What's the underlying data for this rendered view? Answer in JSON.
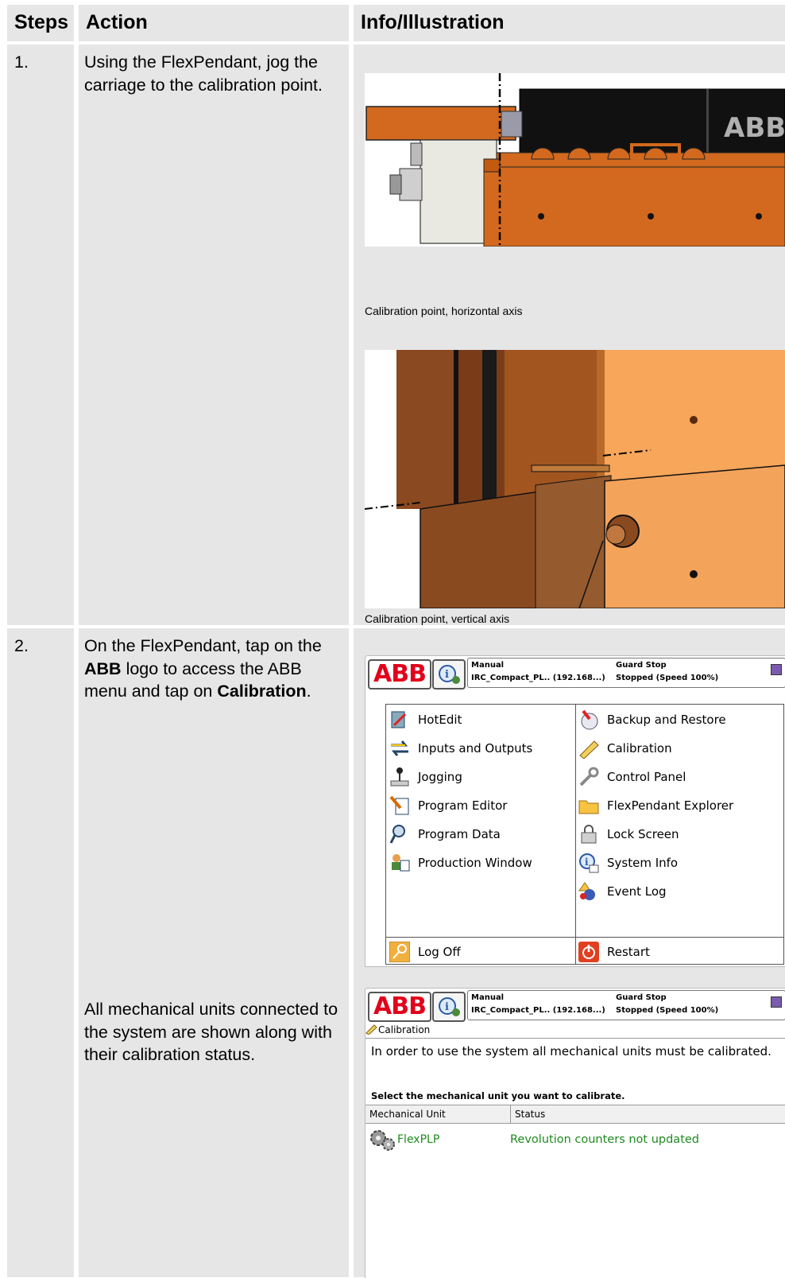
{
  "table": {
    "headers": {
      "steps": "Steps",
      "action": "Action",
      "info": "Info/Illustration"
    },
    "rows": [
      {
        "step": "1.",
        "action": "Using the FlexPendant, jog the carriage to the calibration point.",
        "captions": [
          "Calibration point, horizontal axis",
          "Calibration point, vertical axis"
        ]
      },
      {
        "step": "2.",
        "action_parts": [
          "On the FlexPendant, tap on the ",
          "ABB",
          " logo to access the ABB menu and tap on ",
          "Calibration",
          "."
        ],
        "action2": "All mechanical units connected to the system are shown along with their calibration status."
      }
    ]
  },
  "illustration_horizontal": {
    "logo_text": "ABB"
  },
  "pendant": {
    "logo": "ABB",
    "mode": "Manual",
    "system": "IRC_Compact_PL.. (192.168...)",
    "guard": "Guard Stop",
    "speed": "Stopped (Speed 100%)",
    "menu_left": [
      {
        "label": "HotEdit",
        "icon": "hotedit-icon"
      },
      {
        "label": "Inputs and Outputs",
        "icon": "io-arrows-icon"
      },
      {
        "label": "Jogging",
        "icon": "joystick-icon"
      },
      {
        "label": "Program Editor",
        "icon": "program-editor-icon"
      },
      {
        "label": "Program Data",
        "icon": "program-data-icon"
      },
      {
        "label": "Production Window",
        "icon": "production-window-icon"
      }
    ],
    "menu_right": [
      {
        "label": "Backup and Restore",
        "icon": "backup-icon"
      },
      {
        "label": "Calibration",
        "icon": "calibration-icon"
      },
      {
        "label": "Control Panel",
        "icon": "wrench-icon"
      },
      {
        "label": "FlexPendant Explorer",
        "icon": "folder-icon"
      },
      {
        "label": "Lock Screen",
        "icon": "lock-icon"
      },
      {
        "label": "System Info",
        "icon": "info-icon"
      },
      {
        "label": "Event Log",
        "icon": "event-log-icon"
      }
    ],
    "log_off": "Log Off",
    "restart": "Restart"
  },
  "calibration_screen": {
    "title": "Calibration",
    "message": "In order to use the system all mechanical units must be calibrated.",
    "select_prompt": "Select the mechanical unit you want to calibrate.",
    "col_unit": "Mechanical Unit",
    "col_status": "Status",
    "unit_name": "FlexPLP",
    "unit_status": "Revolution counters not updated"
  },
  "colors": {
    "unit_green": "#1f8a1f",
    "abb_red": "#e2001a",
    "orange": "#d2691e"
  }
}
